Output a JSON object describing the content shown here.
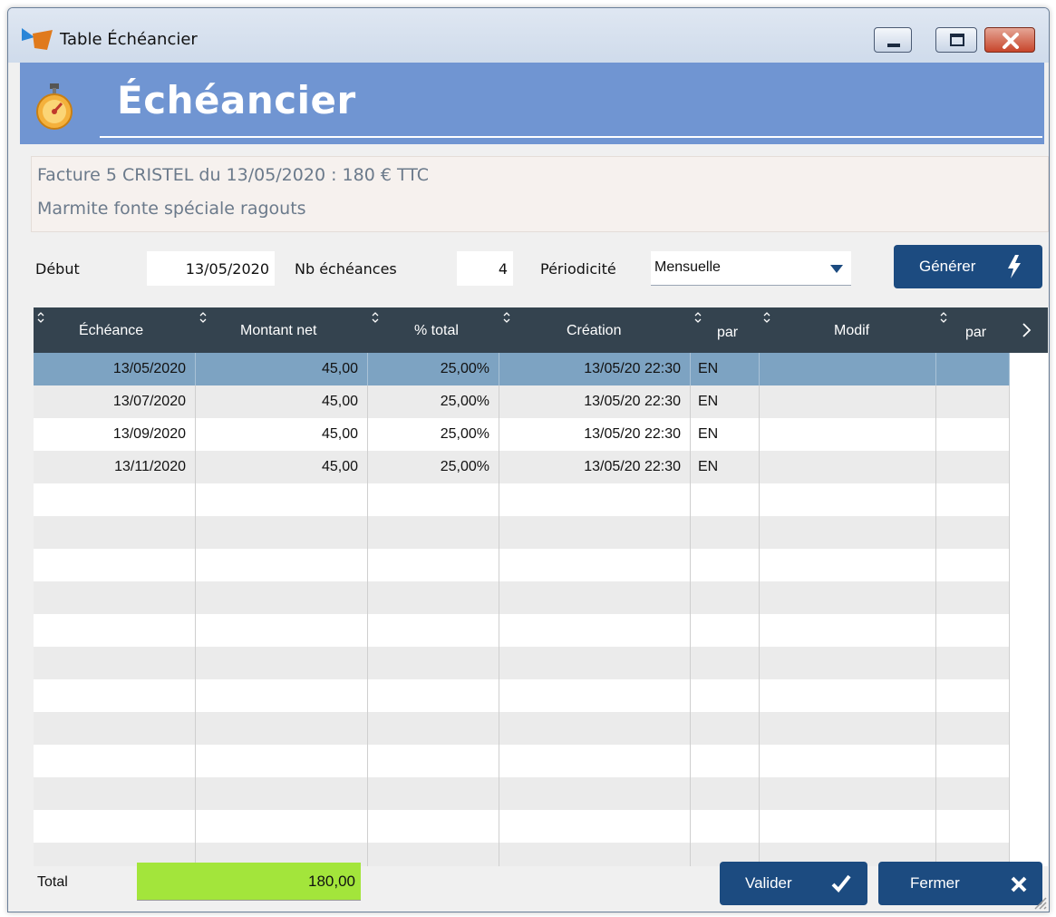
{
  "window": {
    "title": "Table Échéancier"
  },
  "banner": {
    "title": "Échéancier"
  },
  "info": {
    "line1": "Facture 5 CRISTEL du 13/05/2020 : 180 € TTC",
    "line2": "Marmite fonte spéciale ragouts"
  },
  "form": {
    "debut_label": "Début",
    "debut_value": "13/05/2020",
    "nb_label": "Nb échéances",
    "nb_value": "4",
    "periodicite_label": "Périodicité",
    "periodicite_value": "Mensuelle",
    "generate_label": "Générer"
  },
  "table": {
    "columns": [
      "Échéance",
      "Montant net",
      "% total",
      "Création",
      "par",
      "Modif",
      "par"
    ],
    "rows": [
      {
        "echeance": "13/05/2020",
        "montant": "45,00",
        "pct": "25,00%",
        "creation": "13/05/20 22:30",
        "par": "EN",
        "modif": "",
        "par2": ""
      },
      {
        "echeance": "13/07/2020",
        "montant": "45,00",
        "pct": "25,00%",
        "creation": "13/05/20 22:30",
        "par": "EN",
        "modif": "",
        "par2": ""
      },
      {
        "echeance": "13/09/2020",
        "montant": "45,00",
        "pct": "25,00%",
        "creation": "13/05/20 22:30",
        "par": "EN",
        "modif": "",
        "par2": ""
      },
      {
        "echeance": "13/11/2020",
        "montant": "45,00",
        "pct": "25,00%",
        "creation": "13/05/20 22:30",
        "par": "EN",
        "modif": "",
        "par2": ""
      }
    ],
    "selected_row": 0
  },
  "footer": {
    "total_label": "Total",
    "total_value": "180,00",
    "validate_label": "Valider",
    "close_label": "Fermer"
  },
  "colors": {
    "banner": "#7095d2",
    "button": "#1c4b80",
    "header": "#34434f",
    "selected": "#7da3c2",
    "total": "#a3e53b"
  },
  "icons": {
    "app": "app-logo-icon",
    "banner": "stopwatch-icon",
    "generate": "lightning-icon",
    "validate": "checkmark-icon",
    "close": "close-x-icon"
  }
}
